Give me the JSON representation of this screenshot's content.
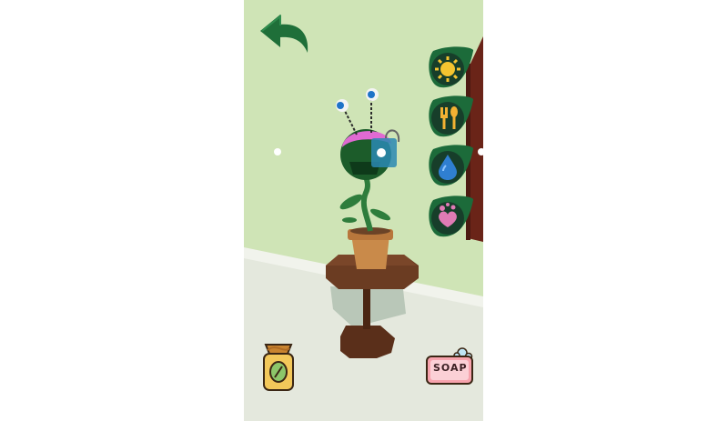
{
  "game": {
    "title": "",
    "soap_label": "SOAP",
    "controls": {
      "back": "back-arrow-icon",
      "sun": "sun-icon",
      "food": "fork-spoon-icon",
      "water": "water-drop-icon",
      "love": "hearts-icon",
      "seed": "seed-bag-icon",
      "soap": "soap-icon"
    }
  },
  "colors": {
    "wall": "#cfe4b6",
    "floor": "#e4e8dd",
    "button_leaf": "#1c6b3a",
    "button_inner": "#173e2a",
    "door": "#6a2418",
    "pot": "#c98a4a",
    "table": "#6b3c22",
    "plant": "#2e7d3c"
  }
}
